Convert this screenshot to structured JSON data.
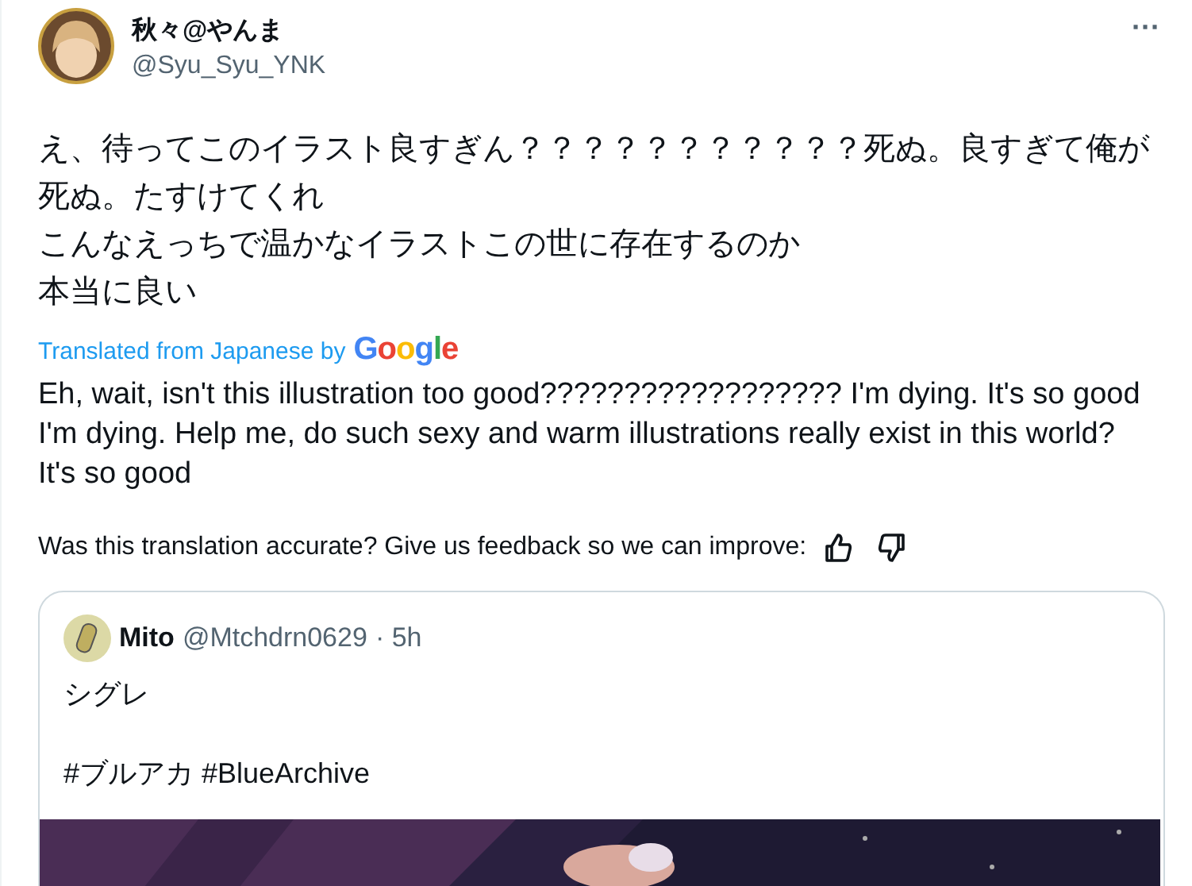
{
  "author": {
    "name": "秋々@やんま",
    "handle": "@Syu_Syu_YNK"
  },
  "more_button": "···",
  "body_lines": [
    "え、待ってこのイラスト良すぎん？？？？？？？？？？？死ぬ。良すぎて俺が死ぬ。たすけてくれ",
    "こんなえっちで温かなイラストこの世に存在するのか",
    "本当に良い"
  ],
  "translation": {
    "label": "Translated from Japanese by",
    "provider": "Google",
    "text": "Eh, wait, isn't this illustration too good?????????????????? I'm dying. It's so good I'm dying. Help me, do such sexy and warm illustrations really exist in this world? It's so good"
  },
  "feedback": {
    "question": "Was this translation accurate? Give us feedback so we can improve:"
  },
  "quote": {
    "name": "Mito",
    "handle": "@Mtchdrn0629",
    "time": "· 5h",
    "text": "シグレ",
    "hashtags": "#ブルアカ #BlueArchive"
  }
}
